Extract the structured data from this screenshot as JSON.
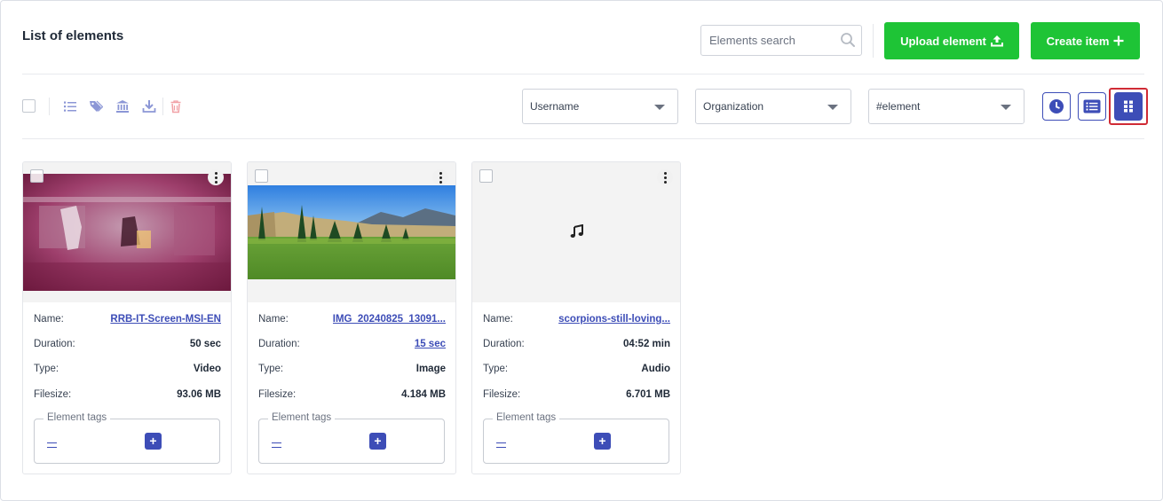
{
  "header": {
    "title": "List of elements",
    "search_placeholder": "Elements search",
    "upload_label": "Upload element",
    "create_label": "Create item"
  },
  "toolbar": {
    "icons": [
      "list-icon",
      "tags-icon",
      "institution-icon",
      "download-icon",
      "trash-icon"
    ]
  },
  "filters": {
    "username": "Username",
    "organization": "Organization",
    "element": "#element"
  },
  "view_modes": [
    "clock-view",
    "list-view",
    "grid-view"
  ],
  "active_view": "grid-view",
  "labels": {
    "name": "Name:",
    "duration": "Duration:",
    "type": "Type:",
    "filesize": "Filesize:",
    "tags": "Element tags",
    "add_tag": "+"
  },
  "cards": [
    {
      "name": "RRB-IT-Screen-MSI-EN",
      "duration": "50 sec",
      "type": "Video",
      "filesize": "93.06 MB",
      "thumbnail": "video-thumbnail"
    },
    {
      "name": "IMG_20240825_13091...",
      "duration": "15 sec",
      "type": "Image",
      "filesize": "4.184 MB",
      "thumbnail": "landscape-photo"
    },
    {
      "name": "scorpions-still-loving...",
      "duration": "04:52 min",
      "type": "Audio",
      "filesize": "6.701 MB",
      "thumbnail": "music-note-icon"
    }
  ],
  "colors": {
    "accent": "#3d4db7",
    "green": "#1ec436",
    "danger": "#d02b35"
  }
}
